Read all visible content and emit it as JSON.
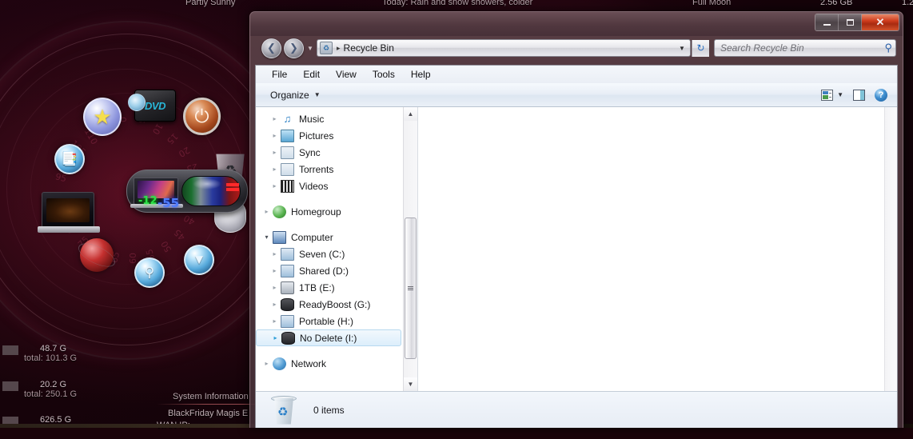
{
  "desktop": {
    "weather_condition": "Partly Sunny",
    "weather_forecast": "Today: Rain and snow showers, colder",
    "moon_phase": "Full Moon",
    "memory_free": "2.56 GB",
    "memory_extra": "1.2",
    "disk_meters": [
      {
        "free": "48.7 G",
        "total": "total: 101.3 G"
      },
      {
        "free": "20.2 G",
        "total": "total: 250.1 G"
      },
      {
        "free": "626.5 G",
        "total": ""
      }
    ],
    "sysinfo_title": "System Information",
    "sysinfo_line2": "BlackFriday  Magis E",
    "sysinfo_line3": "WAN IP:",
    "gadgets": {
      "temp_green": "-12",
      "temp_blue": "-55",
      "dvd_label": "DVD",
      "names": [
        "star-favorites-gadget",
        "dvd-drive-gadget",
        "power-button-gadget",
        "notes-gadget",
        "laptop-gadget",
        "globe-network-gadget",
        "search-gadget",
        "downloads-gadget",
        "recycle-bin-gadget",
        "speaker-volume-gadget"
      ]
    }
  },
  "window": {
    "title_buttons": {
      "minimize": "–",
      "maximize": "▭",
      "close": "✕"
    },
    "address": {
      "path_label": "Recycle Bin",
      "separator": "▸",
      "dropdown_caret": "▼",
      "refresh_glyph": "↻"
    },
    "search": {
      "placeholder": "Search Recycle Bin",
      "icon": "⚲"
    },
    "menus": [
      "File",
      "Edit",
      "View",
      "Tools",
      "Help"
    ],
    "toolbar": {
      "organize_label": "Organize",
      "organize_caret": "▼",
      "views_caret": "▼",
      "help_glyph": "?"
    },
    "navigation": {
      "items": [
        {
          "label": "Music",
          "icon": "music-icon",
          "indent": 1,
          "expander": "▸",
          "selected": false
        },
        {
          "label": "Pictures",
          "icon": "pictures-icon",
          "indent": 1,
          "expander": "▸",
          "selected": false
        },
        {
          "label": "Sync",
          "icon": "folder-icon",
          "indent": 1,
          "expander": "▸",
          "selected": false
        },
        {
          "label": "Torrents",
          "icon": "folder-icon",
          "indent": 1,
          "expander": "▸",
          "selected": false
        },
        {
          "label": "Videos",
          "icon": "videos-icon",
          "indent": 1,
          "expander": "▸",
          "selected": false
        },
        {
          "label": "Homegroup",
          "icon": "homegroup-icon",
          "indent": 0,
          "expander": "▸",
          "selected": false,
          "gap_before": true
        },
        {
          "label": "Computer",
          "icon": "computer-icon",
          "indent": 0,
          "expander": "▾",
          "selected": false,
          "gap_before": true
        },
        {
          "label": "Seven (C:)",
          "icon": "windows-drive-icon",
          "indent": 1,
          "expander": "▸",
          "selected": false
        },
        {
          "label": "Shared (D:)",
          "icon": "hard-drive-icon",
          "indent": 1,
          "expander": "▸",
          "selected": false
        },
        {
          "label": "1TB (E:)",
          "icon": "optical-drive-icon",
          "indent": 1,
          "expander": "▸",
          "selected": false
        },
        {
          "label": "ReadyBoost (G:)",
          "icon": "usb-drive-icon",
          "indent": 1,
          "expander": "▸",
          "selected": false
        },
        {
          "label": "Portable (H:)",
          "icon": "hard-drive-icon",
          "indent": 1,
          "expander": "▸",
          "selected": false
        },
        {
          "label": "No Delete (I:)",
          "icon": "usb-drive-icon",
          "indent": 1,
          "expander": "▸",
          "selected": true
        },
        {
          "label": "Network",
          "icon": "network-icon",
          "indent": 0,
          "expander": "▸",
          "selected": false,
          "gap_before": true
        }
      ],
      "scroll_up": "▲",
      "scroll_down": "▼"
    },
    "status": {
      "item_count": "0 items",
      "icon": "recycle-bin-icon"
    }
  }
}
